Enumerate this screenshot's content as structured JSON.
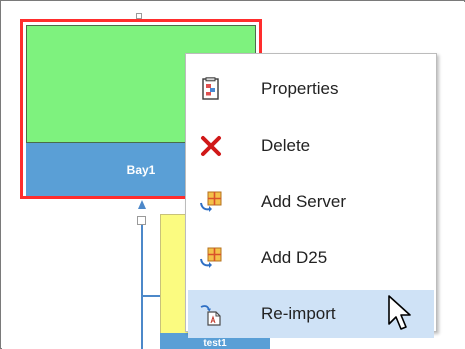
{
  "diagram": {
    "bay_label": "Bay1",
    "lower_block_label": "test1"
  },
  "context_menu": {
    "items": [
      {
        "label": "Properties",
        "icon": "properties-icon"
      },
      {
        "label": "Delete",
        "icon": "delete-icon"
      },
      {
        "label": "Add Server",
        "icon": "add-server-icon"
      },
      {
        "label": "Add D25",
        "icon": "add-d25-icon"
      },
      {
        "label": "Re-import",
        "icon": "reimport-icon",
        "hovered": true
      }
    ]
  },
  "colors": {
    "selection_border": "#ff2d2d",
    "bay_top": "#7ef27e",
    "bay_bottom": "#5a9fd6",
    "menu_hover": "#cfe2f6",
    "delete_x": "#d01818"
  }
}
